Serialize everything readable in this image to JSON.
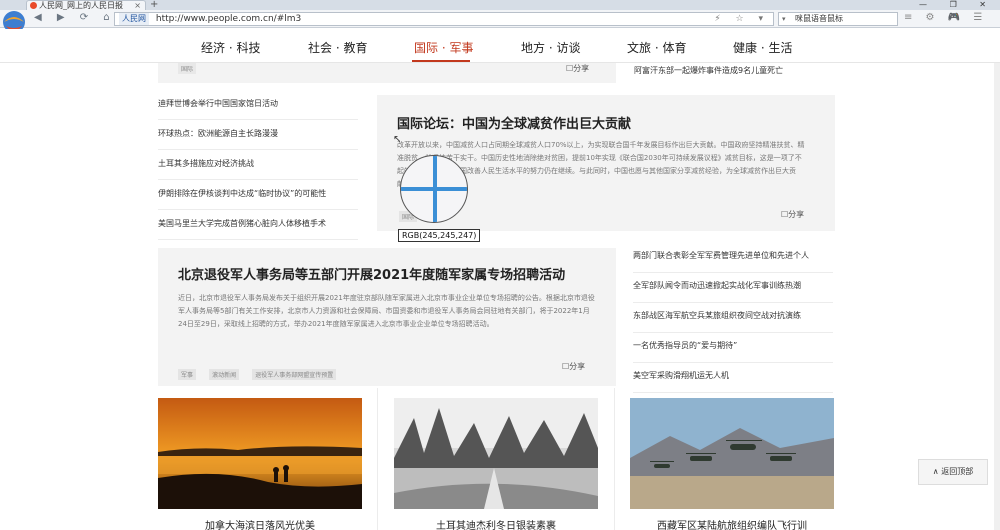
{
  "browser": {
    "tab_title": "人民网_网上的人民日报",
    "tab_close": "×",
    "new_tab": "+",
    "window_controls": "— ❐ ✕",
    "nav_icons": "◀ ▶ ⟳ ⌂ ☆",
    "url_site": "人民网",
    "url": "http://www.people.com.cn/#lm3",
    "url_icons": "⚡ ☆ ▾",
    "search_text": "咪鼠语音鼠标",
    "search_dropdown": "▾",
    "toolbar_right_icons": "≡ ⚙ 🎮 ☰"
  },
  "site_nav": {
    "items": [
      "经济 · 科技",
      "社会 · 教育",
      "国际 · 军事",
      "地方 · 访谈",
      "文旅 · 体育",
      "健康 · 生活"
    ],
    "active": "国际 · 军事"
  },
  "previous_panel": {
    "tag": "国际",
    "share": "☐分享"
  },
  "top_news": "阿富汗东部一起爆炸事件造成9名儿童死亡",
  "left_list": [
    "迪拜世博会举行中国国家馆日活动",
    "环球热点：欧洲能源自主长路漫漫",
    "土耳其多措施应对经济挑战",
    "伊朗排除在伊核谈判中达成“临时协议”的可能性",
    "美国马里兰大学完成首例猪心脏向人体移植手术"
  ],
  "feature": {
    "title": "国际论坛：中国为全球减贫作出巨大贡献",
    "summary": "改革开放以来，中国减贫人口占同期全球减贫人口70%以上，为实现联合国千年发展目标作出巨大贡献。中国政府坚持精准扶贫、精准脱贫，并坚持苦干实干。中国历史性地消除绝对贫困，提前10年实现《联合国2030年可持续发展议程》减贫目标，这是一项了不起的成就。如今，中国改善人民生活水平的努力仍在继续。与此同时，中国也愿与其他国家分享减贫经验，为全球减贫作出巨大贡献。",
    "tag": "国际",
    "share": "☐分享"
  },
  "main_story": {
    "title": "北京退役军人事务局等五部门开展2021年度随军家属专场招聘活动",
    "summary": "近日，北京市退役军人事务局发布关于组织开展2021年度驻京部队随军家属进入北京市事业企业单位专场招聘的公告。根据北京市退役军人事务局等5部门有关工作安排，北京市人力资源和社会保障局、市国资委和市退役军人事务局会同驻地有关部门，将于2022年1月24日至29日，采取线上招聘的方式，举办2021年度随军家属进入北京市事业企业单位专场招聘活动。",
    "tags": [
      "军事",
      "滚动新闻",
      "退役军人事务部网盟宣传预置"
    ],
    "share": "☐分享"
  },
  "right_list": [
    "两部门联合表彰全军军费管理先进单位和先进个人",
    "全军部队闻令而动迅速掀起实战化军事训练热潮",
    "东部战区海军航空兵某旅组织夜间空战对抗演练",
    "一名优秀指导员的“爱与期待”",
    "美空军采购滑翔机运无人机"
  ],
  "photos": [
    {
      "caption": "加拿大海滨日落风光优美"
    },
    {
      "caption": "土耳其迪杰利冬日银装素裹"
    },
    {
      "caption": "西藏军区某陆航旅组织编队飞行训"
    }
  ],
  "back_to_top": "∧ 返回顶部",
  "color_picker": {
    "rgb_label": "RGB(245,245,247)",
    "cursor": "↖"
  },
  "colors": {
    "accent": "#c2381d",
    "panel_bg": "#f3f3f3",
    "picker_line": "#3b8fd6"
  }
}
